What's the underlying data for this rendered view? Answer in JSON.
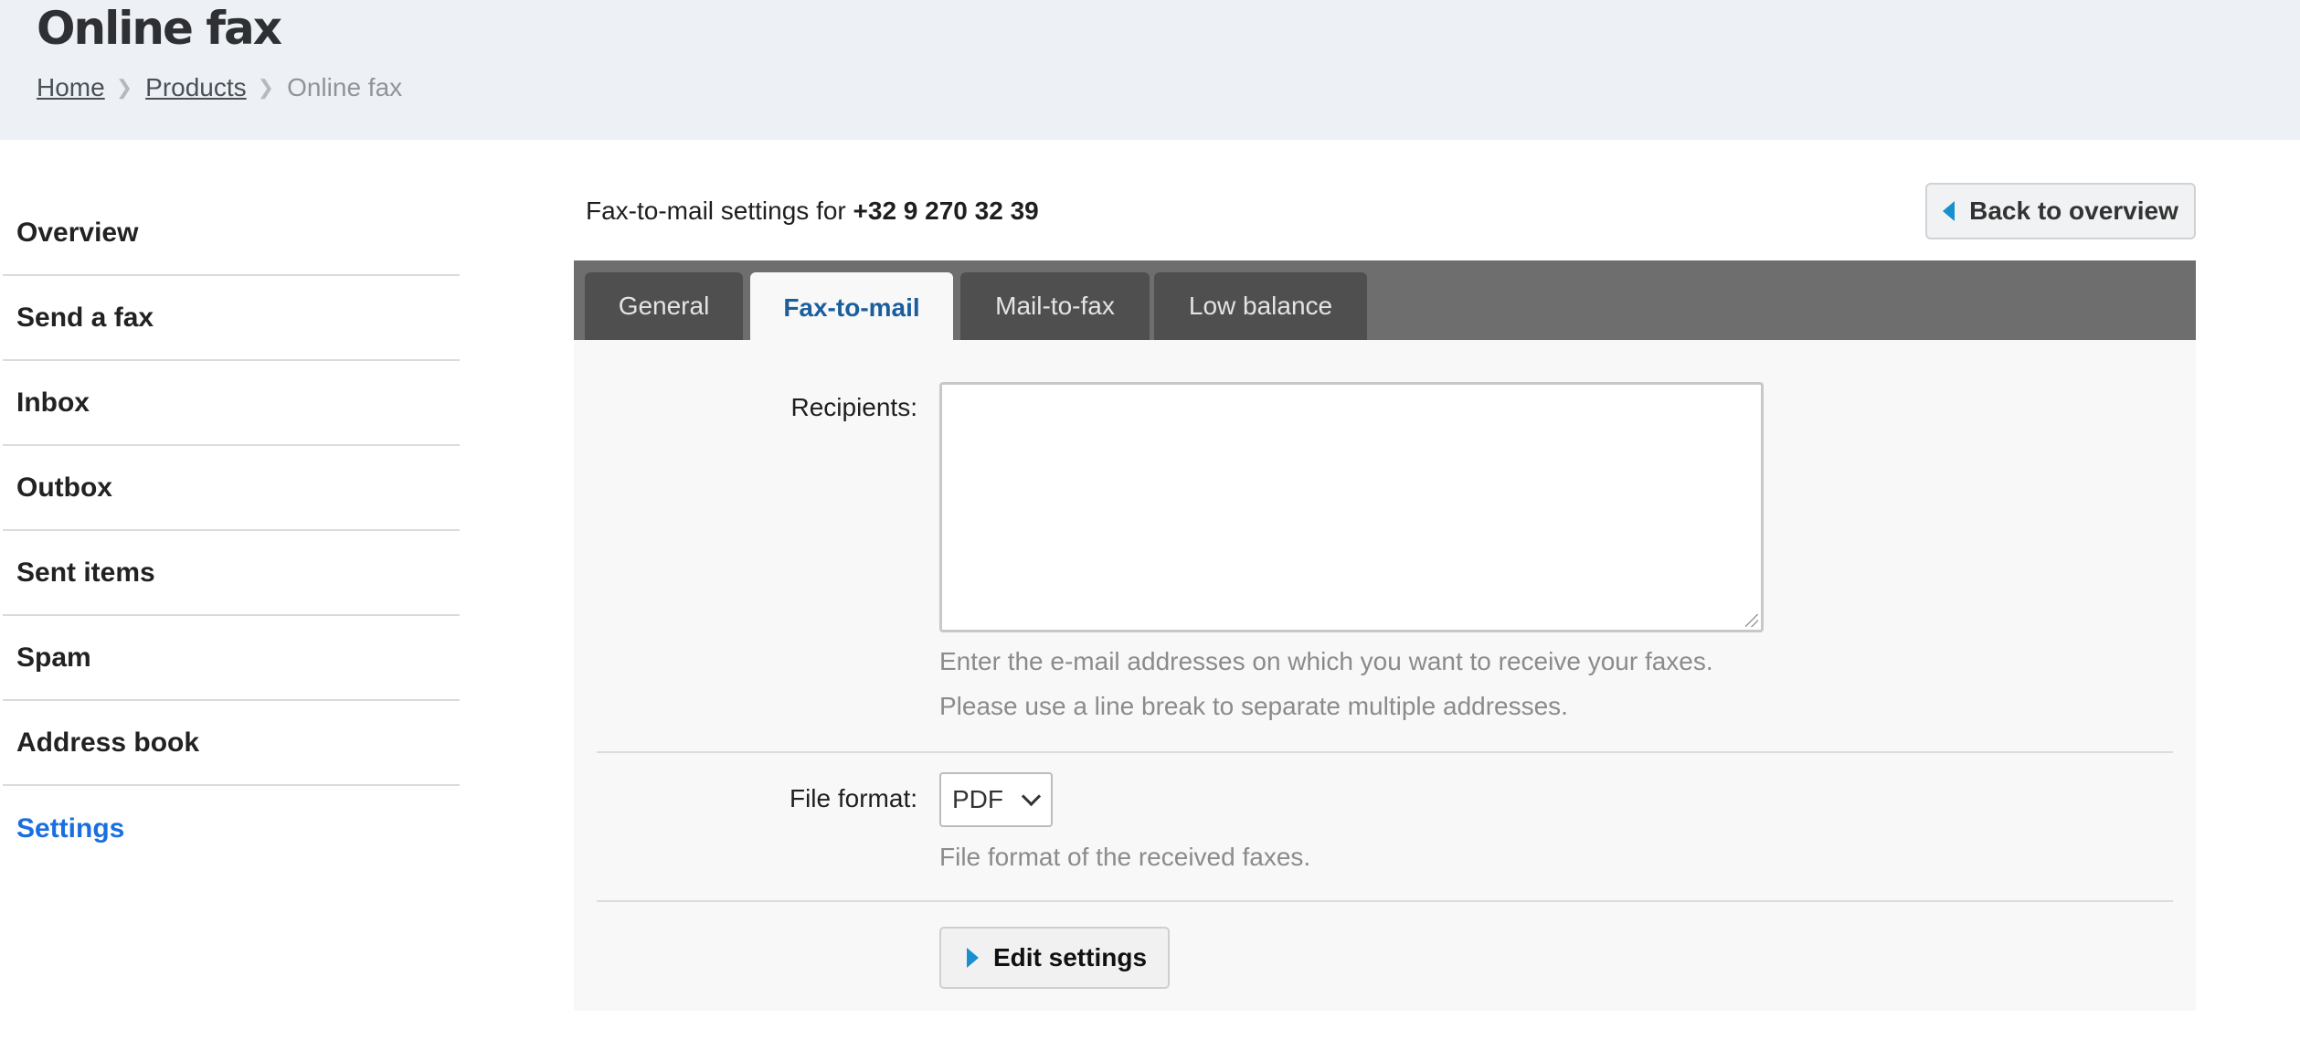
{
  "header": {
    "title": "Online fax",
    "breadcrumb": [
      {
        "label": "Home"
      },
      {
        "label": "Products"
      },
      {
        "label": "Online fax"
      }
    ],
    "separator": "❯"
  },
  "sidebar": {
    "items": [
      {
        "label": "Overview"
      },
      {
        "label": "Send a fax"
      },
      {
        "label": "Inbox"
      },
      {
        "label": "Outbox"
      },
      {
        "label": "Sent items"
      },
      {
        "label": "Spam"
      },
      {
        "label": "Address book"
      },
      {
        "label": "Settings",
        "active": true
      }
    ],
    "active_color": "#1a6fe0"
  },
  "main": {
    "heading_prefix": "Fax-to-mail settings for",
    "phone_number": "+32 9 270 32 39",
    "back_button": "Back to overview",
    "tabs": [
      {
        "label": "General"
      },
      {
        "label": "Fax-to-mail",
        "active": true
      },
      {
        "label": "Mail-to-fax"
      },
      {
        "label": "Low balance"
      }
    ],
    "form": {
      "recipients": {
        "label": "Recipients:",
        "value": "",
        "help_line1": "Enter the e-mail addresses on which you want to receive your faxes.",
        "help_line2": "Please use a line break to separate multiple addresses."
      },
      "file_format": {
        "label": "File format:",
        "selected": "PDF",
        "help": "File format of the received faxes."
      },
      "edit_button": "Edit settings"
    }
  },
  "icons": {
    "back": "caret-left-icon",
    "edit": "caret-right-icon",
    "select": "chevron-down-icon",
    "accent_color": "#1a8fcf"
  }
}
